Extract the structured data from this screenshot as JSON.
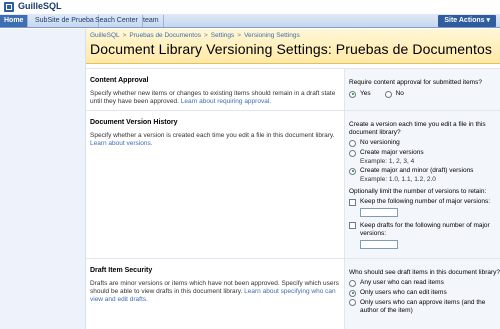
{
  "header": {
    "site_title": "GuilleSQL",
    "logo_icon": "sharepoint-logo-icon"
  },
  "tabs": [
    "Home",
    "SubSite de Prueba",
    "Seach Center",
    "team"
  ],
  "site_actions": "Site Actions ▾",
  "breadcrumb": [
    "GuilleSQL",
    "Pruebas de Documentos",
    "Settings",
    "Versioning Settings"
  ],
  "breadcrumb_sep": ">",
  "page_title": "Document Library Versioning Settings: Pruebas de Documentos",
  "content_approval": {
    "title": "Content Approval",
    "desc": "Specify whether new items or changes to existing items should remain in a draft state until they have been approved.",
    "link": "Learn about requiring approval.",
    "question": "Require content approval for submitted items?",
    "yes": "Yes",
    "no": "No"
  },
  "version_history": {
    "title": "Document Version History",
    "desc": "Specify whether a version is created each time you edit a file in this document library.",
    "link": "Learn about versions.",
    "question": "Create a version each time you edit a file in this document library?",
    "opt_none": "No versioning",
    "opt_major": "Create major versions",
    "ex_major": "Example: 1, 2, 3, 4",
    "opt_minor": "Create major and minor (draft) versions",
    "ex_minor": "Example: 1.0, 1.1, 1.2, 2.0",
    "limit_q": "Optionally limit the number of versions to retain:",
    "keep_major": "Keep the following number of major versions:",
    "keep_drafts": "Keep drafts for the following number of major versions:"
  },
  "draft_security": {
    "title": "Draft Item Security",
    "desc": "Drafts are minor versions or items which have not been approved. Specify which users should be able to view drafts in this document library.",
    "link": "Learn about specifying who can view and edit drafts.",
    "question": "Who should see draft items in this document library?",
    "opt_any": "Any user who can read items",
    "opt_edit": "Only users who can edit items",
    "opt_approve": "Only users who can approve items (and the author of the item)"
  }
}
